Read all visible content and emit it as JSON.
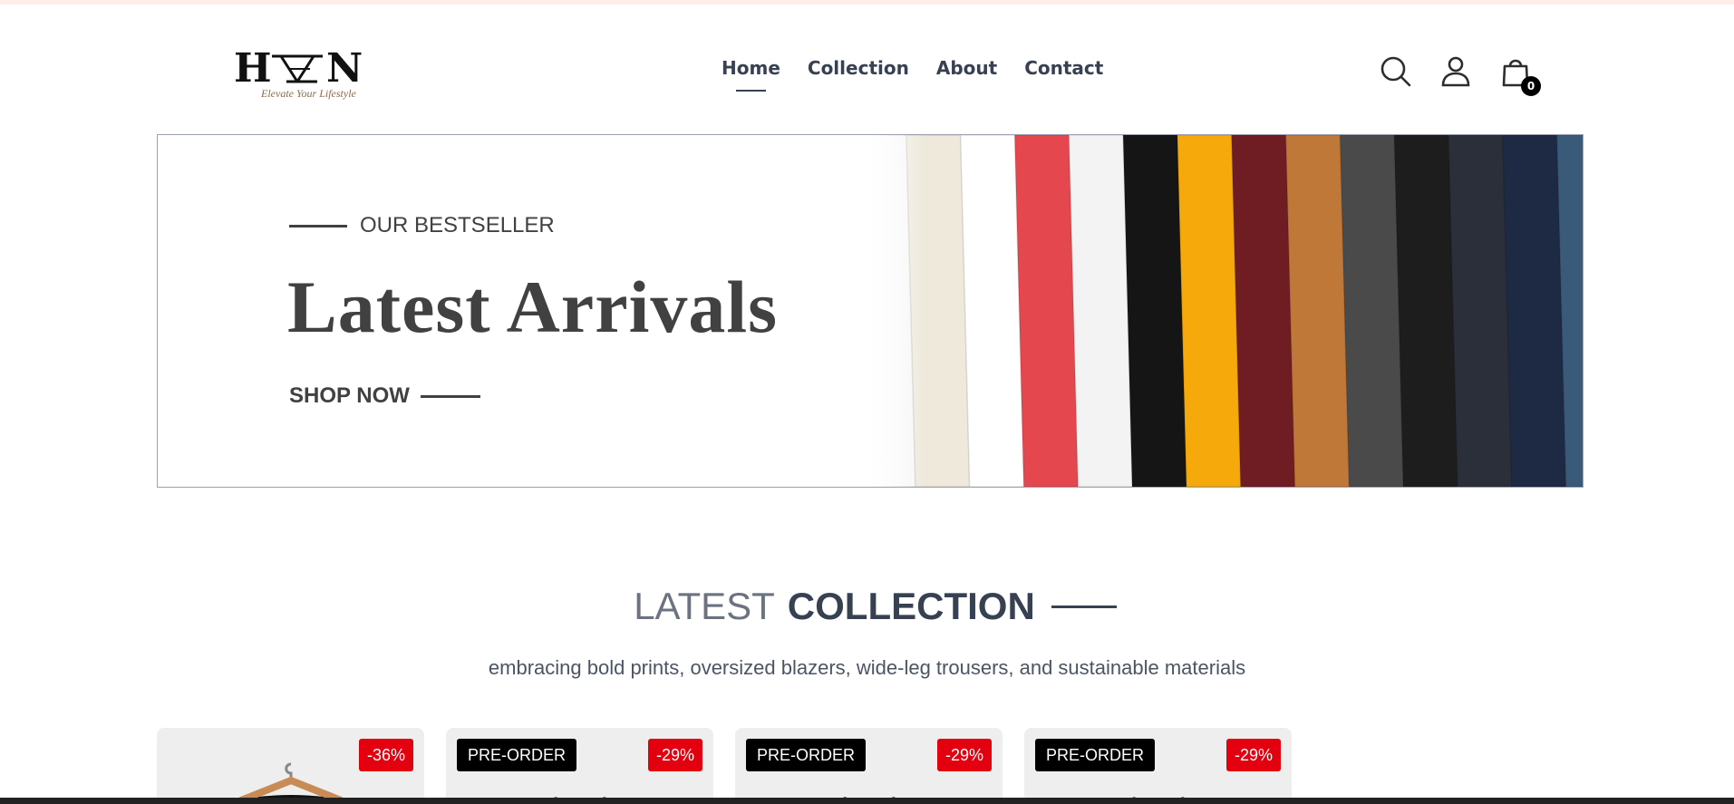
{
  "logo": {
    "word": "HAVEN",
    "tagline": "Elevate Your Lifestyle"
  },
  "nav": {
    "items": [
      {
        "label": "Home",
        "active": true
      },
      {
        "label": "Collection",
        "active": false
      },
      {
        "label": "About",
        "active": false
      },
      {
        "label": "Contact",
        "active": false
      }
    ]
  },
  "header_icons": {
    "search": "search-icon",
    "profile": "user-icon",
    "cart": "shopping-bag-icon",
    "cart_count": "0"
  },
  "hero": {
    "eyebrow": "OUR BESTSELLER",
    "title": "Latest Arrivals",
    "cta": "SHOP NOW",
    "shirt_colors": [
      "#f7f7f7",
      "#efe9dc",
      "#ffffff",
      "#e5474f",
      "#f3f3f3",
      "#151515",
      "#f6a90a",
      "#6f1d22",
      "#c07838",
      "#4a4a4a",
      "#1d1d1d",
      "#2a2f3a",
      "#1e2a44",
      "#3a5a7a"
    ]
  },
  "collection": {
    "title_light": "LATEST",
    "title_bold": "COLLECTION",
    "subtitle": "embracing bold prints, oversized blazers, wide-leg trousers, and sustainable materials",
    "products": [
      {
        "preorder": "",
        "discount": "-36%",
        "shirt_color": "#111111"
      },
      {
        "preorder": "PRE-ORDER",
        "discount": "-29%",
        "shirt_color": "#7a3138"
      },
      {
        "preorder": "PRE-ORDER",
        "discount": "-29%",
        "shirt_color": "#2b3442"
      },
      {
        "preorder": "PRE-ORDER",
        "discount": "-29%",
        "shirt_color": "#2e5a2e"
      }
    ]
  }
}
